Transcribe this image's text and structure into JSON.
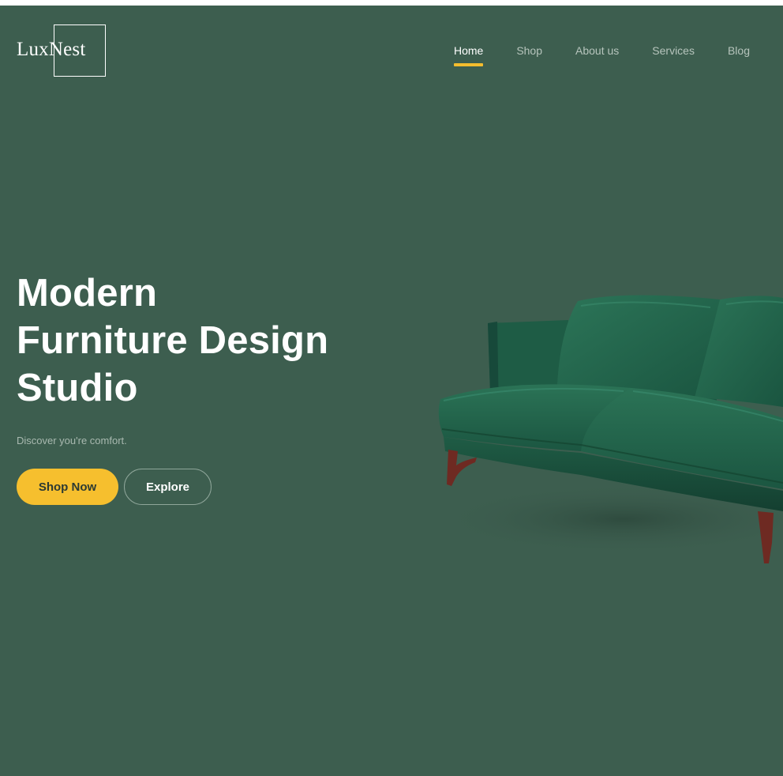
{
  "brand": {
    "name": "LuxNest"
  },
  "nav": {
    "items": [
      {
        "label": "Home",
        "active": true
      },
      {
        "label": "Shop",
        "active": false
      },
      {
        "label": "About us",
        "active": false
      },
      {
        "label": "Services",
        "active": false
      },
      {
        "label": "Blog",
        "active": false
      }
    ]
  },
  "hero": {
    "title_lines": [
      "Modern",
      "Furniture Design",
      "Studio"
    ],
    "subtitle": "Discover you're comfort.",
    "primary_button": "Shop Now",
    "secondary_button": "Explore",
    "image": "green-velvet-sofa"
  },
  "colors": {
    "background": "#3d5e4f",
    "accent": "#f6bf2e",
    "text": "#ffffff",
    "muted_text": "#b6c4bc"
  }
}
